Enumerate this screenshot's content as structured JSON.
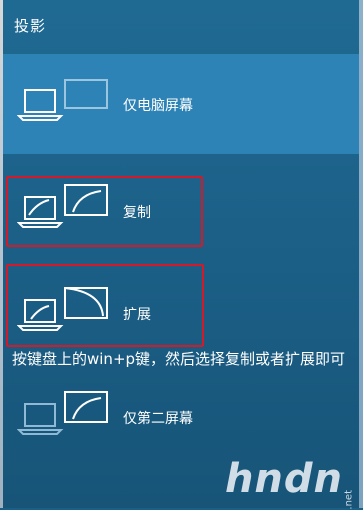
{
  "panel": {
    "title": "投影"
  },
  "options": [
    {
      "label": "仅电脑屏幕",
      "icon": "pc-screen-only-icon",
      "selected": true
    },
    {
      "label": "复制",
      "icon": "duplicate-icon",
      "selected": false
    },
    {
      "label": "扩展",
      "icon": "extend-icon",
      "selected": false
    },
    {
      "label": "仅第二屏幕",
      "icon": "second-screen-only-icon",
      "selected": false
    }
  ],
  "annotation": {
    "text": "按键盘上的win+p键，然后选择复制或者扩展即可"
  },
  "watermark": {
    "text": "hndn",
    "suffix": ".net"
  },
  "colors": {
    "panel": "#1b5e85",
    "selected": "#2d83b6",
    "highlight": "#d11a2a",
    "text": "#ffffff"
  }
}
